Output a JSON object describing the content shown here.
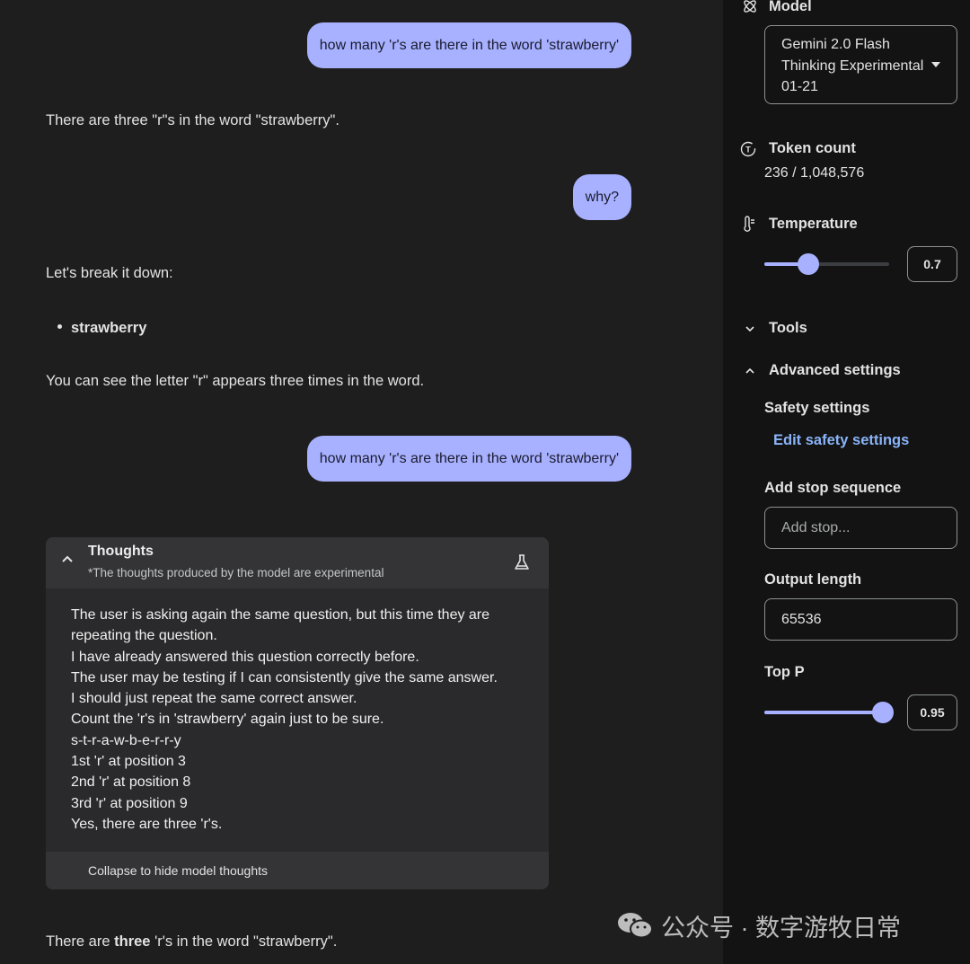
{
  "chat": {
    "messages": [
      {
        "role": "user",
        "text": "how many 'r's are there in the word 'strawberry'"
      },
      {
        "role": "model",
        "text": "There are three \"r\"s in the word \"strawberry\"."
      },
      {
        "role": "user",
        "text": "why?"
      },
      {
        "role": "model",
        "intro": "Let's break it down:",
        "bullet": "strawberry",
        "outro": "You can see the letter \"r\" appears three times in the word."
      },
      {
        "role": "user",
        "text": "how many 'r's are there in the word 'strawberry'"
      },
      {
        "role": "model",
        "final_prefix": "There are ",
        "final_bold": "three",
        "final_suffix": " 'r's in the word \"strawberry\"."
      }
    ],
    "thoughts": {
      "title": "Thoughts",
      "subtitle": "*The thoughts produced by the model are experimental",
      "lines": [
        "The user is asking again the same question, but this time they are",
        "repeating the question.",
        "I have already answered this question correctly before.",
        "The user may be testing if I can consistently give the same answer.",
        "I should just repeat the same correct answer.",
        "Count the 'r's in 'strawberry' again just to be sure.",
        "s-t-r-a-w-b-e-r-r-y",
        "1st 'r' at position 3",
        "2nd 'r' at position 8",
        "3rd 'r' at position 9",
        "Yes, there are three 'r's."
      ],
      "collapse_label": "Collapse to hide model thoughts"
    }
  },
  "sidebar": {
    "model_label": "Model",
    "model_value_lines": [
      "Gemini 2.0 Flash",
      "Thinking Experimental",
      "01-21"
    ],
    "token_label": "Token count",
    "token_value": "236 / 1,048,576",
    "temperature_label": "Temperature",
    "temperature_value": "0.7",
    "temperature_fraction": 0.35,
    "tools_label": "Tools",
    "advanced_label": "Advanced settings",
    "safety_label": "Safety settings",
    "safety_link": "Edit safety settings",
    "stop_label": "Add stop sequence",
    "stop_placeholder": "Add stop...",
    "output_label": "Output length",
    "output_value": "65536",
    "top_p_label": "Top P",
    "top_p_value": "0.95",
    "top_p_fraction": 0.95
  },
  "watermark": {
    "text": "公众号 · 数字游牧日常"
  },
  "colors": {
    "accent": "#a8b1ff",
    "link": "#8ab4f8",
    "background": "#1e1e1e",
    "sidebar_background": "#131314"
  }
}
